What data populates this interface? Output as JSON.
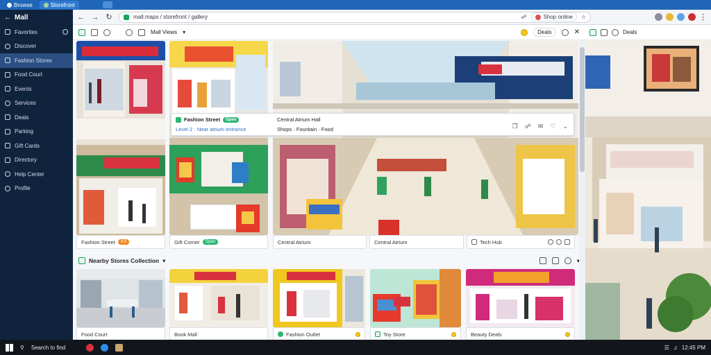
{
  "window": {
    "tabs": [
      {
        "label": "Browse",
        "active": false
      },
      {
        "label": "Storefront",
        "active": true
      }
    ]
  },
  "sidebar": {
    "title": "Mall",
    "items": [
      {
        "label": "Favorites",
        "icon": "star-icon"
      },
      {
        "label": "Discover",
        "icon": "compass-icon",
        "active": true
      },
      {
        "label": "Fashion Stores",
        "icon": "shirt-icon"
      },
      {
        "label": "Food Court",
        "icon": "fork-icon"
      },
      {
        "label": "Events",
        "icon": "calendar-icon"
      },
      {
        "label": "Services",
        "icon": "bell-icon"
      },
      {
        "label": "Deals",
        "icon": "tag-icon"
      },
      {
        "label": "Parking",
        "icon": "car-icon"
      },
      {
        "label": "Gift Cards",
        "icon": "gift-icon"
      },
      {
        "label": "Directory",
        "icon": "map-icon"
      },
      {
        "label": "Help Center",
        "icon": "help-icon"
      },
      {
        "label": "Profile",
        "icon": "user-icon"
      }
    ]
  },
  "address": {
    "url": "mall.maps / storefront / gallery",
    "account_label": "Shop online",
    "icons": [
      "back-icon",
      "forward-icon",
      "refresh-icon",
      "star-icon",
      "extensions-icon",
      "menu-icon"
    ]
  },
  "toolbar": {
    "view_label": "Mall Views",
    "filter_label": "Deals",
    "right_icons": [
      "coin-icon",
      "search-icon",
      "close-icon"
    ]
  },
  "tiles": {
    "t1_caption": "Fashion Street",
    "t1_badge": "4.5",
    "t2_caption": "Gift Corner",
    "t2_badge": "Open",
    "t3_caption": "Central Atrium",
    "t4_caption": "Tech Hub",
    "info_title": "Fashion Street",
    "info_badge": "Open",
    "info_sub": "Level 2 · Near atrium entrance",
    "info_title2": "Central Atrium Hall",
    "info_sub2": "Shops · Fountain · Food",
    "b1_caption": "Food Court",
    "b2_caption": "Book Mall",
    "b3_caption": "Fashion Outlet",
    "b4_caption": "Toy Store",
    "b5_caption": "Beauty Deals"
  },
  "section": {
    "title": "Nearby Stores Collection",
    "dropdown": "▾"
  },
  "right_panel": {
    "title": "Deals"
  },
  "taskbar": {
    "search": "Search to find",
    "time": "12:45 PM"
  },
  "colors": {
    "accent": "#1f66b8",
    "sidebar": "#10233d",
    "green": "#2bb673",
    "orange": "#f08a1e"
  }
}
